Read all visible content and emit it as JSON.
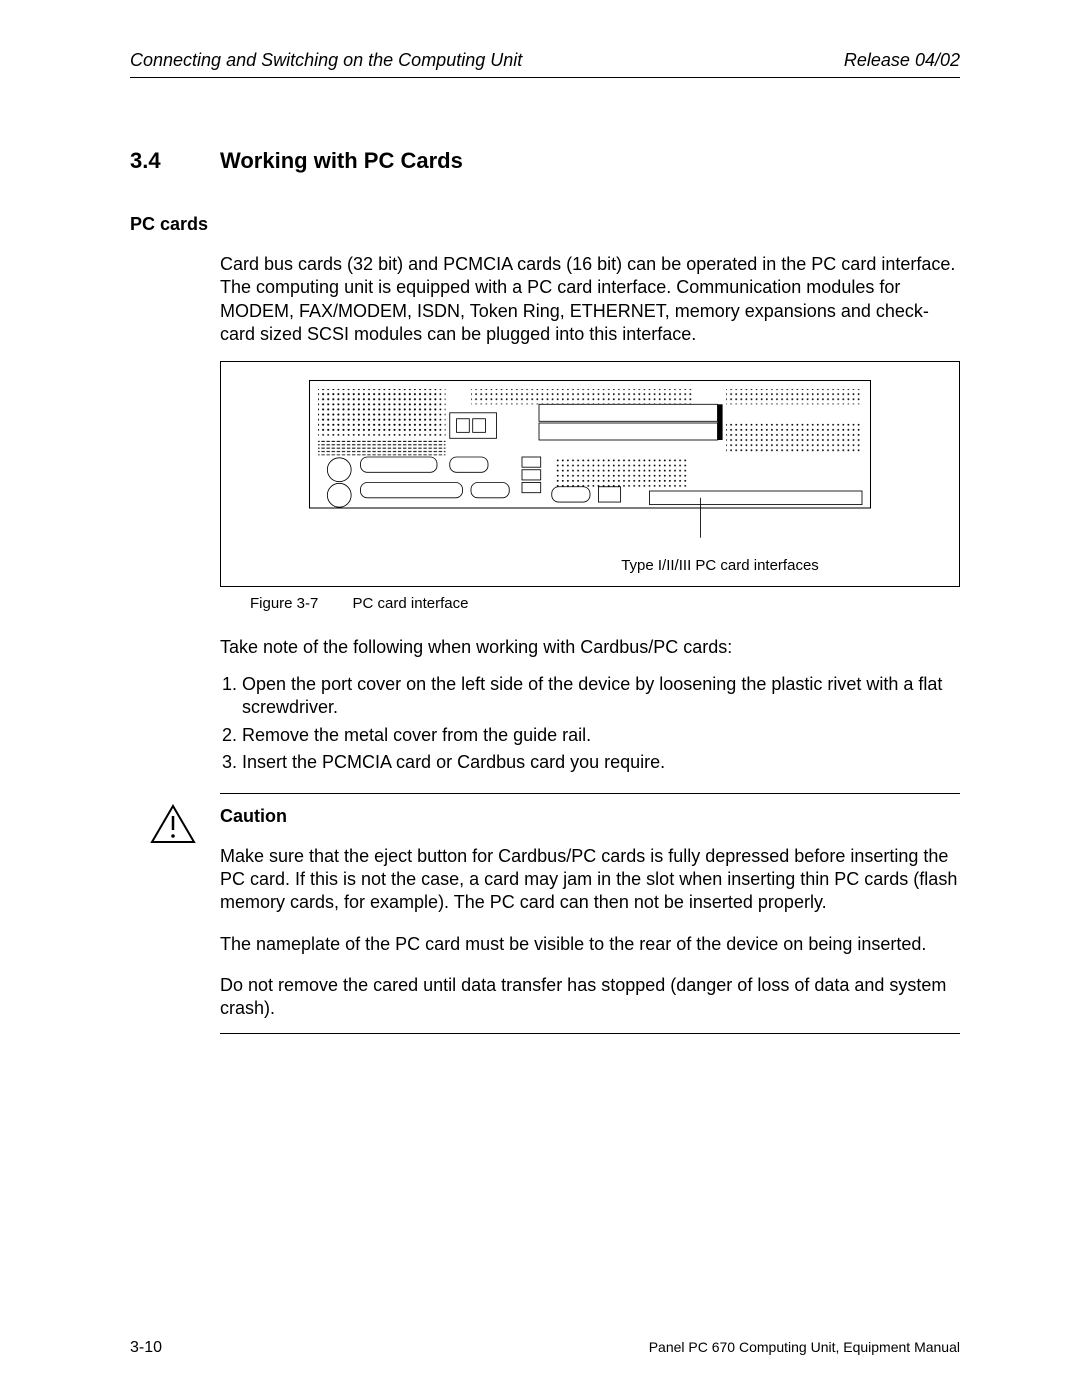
{
  "header": {
    "left": "Connecting and Switching on the Computing Unit",
    "right": "Release 04/02"
  },
  "section": {
    "number": "3.4",
    "title": "Working with PC Cards"
  },
  "subhead": "PC cards",
  "intro": "Card bus cards (32 bit) and PCMCIA cards (16 bit) can be operated in the PC card interface. The computing unit is equipped with a PC card interface. Communication modules for MODEM, FAX/MODEM, ISDN, Token Ring, ETHERNET, memory expansions and check-card sized SCSI modules can be plugged into this interface.",
  "figure": {
    "callout": "Type I/II/III PC card interfaces",
    "label": "Figure 3-7",
    "caption": "PC card interface"
  },
  "note_intro": "Take note of the following when working with Cardbus/PC cards:",
  "steps": [
    "Open the port cover on the left side of the device by loosening the plastic rivet with a flat screwdriver.",
    "Remove the metal cover from the guide rail.",
    "Insert the PCMCIA card or Cardbus card you require."
  ],
  "caution": {
    "title": "Caution",
    "p1": "Make sure that the eject button for Cardbus/PC cards is fully depressed before inserting the PC card. If this is not the case, a card may jam in the slot when inserting thin PC cards (flash memory cards, for example). The PC card can then not be inserted properly.",
    "p2": "The nameplate of the PC card must be visible to the rear of the device on being inserted.",
    "p3": "Do not remove the cared until data transfer has stopped (danger of loss of data and system crash)."
  },
  "footer": {
    "page": "3-10",
    "manual": "Panel PC 670 Computing Unit, Equipment Manual"
  }
}
